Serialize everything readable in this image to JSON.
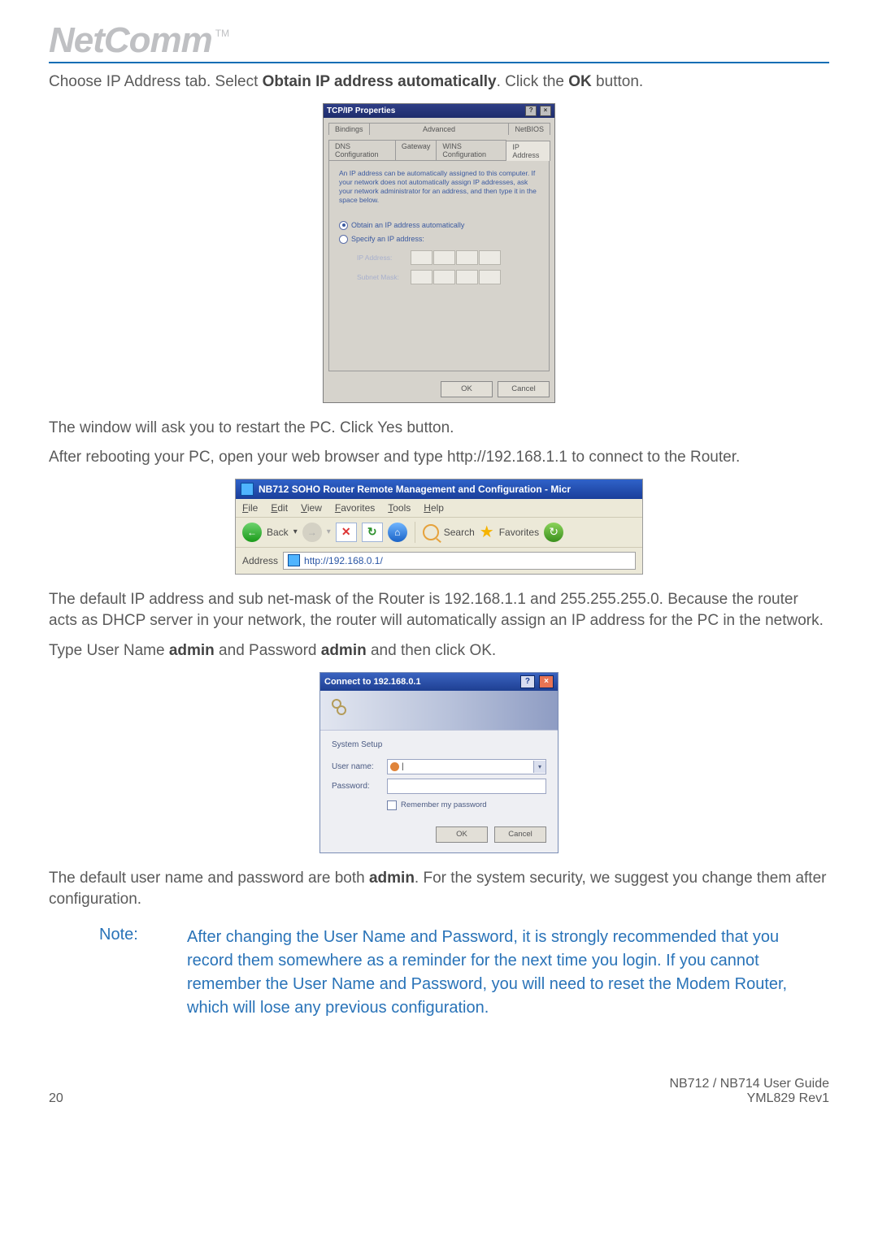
{
  "brand": {
    "name": "NetComm",
    "tm": "TM"
  },
  "p1": {
    "t1": "Choose IP Address tab. Select ",
    "b1": "Obtain IP address automatically",
    "t2": ". Click the ",
    "b2": "OK",
    "t3": " button."
  },
  "tcpip": {
    "title": "TCP/IP Properties",
    "win_help": "?",
    "win_close": "×",
    "tabs_top": {
      "bindings": "Bindings",
      "advanced": "Advanced",
      "netbios": "NetBIOS"
    },
    "tabs_bot": {
      "dns": "DNS Configuration",
      "gateway": "Gateway",
      "wins": "WINS Configuration",
      "ip": "IP Address"
    },
    "info": "An IP address can be automatically assigned to this computer. If your network does not automatically assign IP addresses, ask your network administrator for an address, and then type it in the space below.",
    "opt_auto": "Obtain an IP address automatically",
    "opt_spec": "Specify an IP address:",
    "ip_label": "IP Address:",
    "mask_label": "Subnet Mask:",
    "ok": "OK",
    "cancel": "Cancel"
  },
  "p2": "The window will ask you to restart the PC. Click Yes button.",
  "p3": "After rebooting your PC, open your web browser and type http://192.168.1.1 to connect to the Router.",
  "ie": {
    "title": "NB712 SOHO Router Remote Management and Configuration - Micr",
    "menu": {
      "file": "File",
      "edit": "Edit",
      "view": "View",
      "favorites": "Favorites",
      "tools": "Tools",
      "help": "Help"
    },
    "toolbar": {
      "back": "Back",
      "back_arrow": "←",
      "dd": "▾",
      "fwd": "→",
      "stop": "✕",
      "refresh": "↻",
      "home": "⌂",
      "search": "Search",
      "favorites": "Favorites",
      "star": "★",
      "hist": "↻"
    },
    "addr_label": "Address",
    "url": "http://192.168.0.1/"
  },
  "p4": "The default IP address and sub net-mask of the Router is 192.168.1.1 and 255.255.255.0. Because the router acts as DHCP server in your network, the router will automatically assign an IP address for the PC in the network.",
  "p5": {
    "t1": "Type User Name ",
    "b1": "admin",
    "t2": " and Password ",
    "b2": "admin",
    "t3": " and then click OK."
  },
  "conn": {
    "title": "Connect to 192.168.0.1",
    "help": "?",
    "close": "×",
    "subtitle": "System Setup",
    "user_label": "User name:",
    "pass_label": "Password:",
    "user_cursor": "|",
    "dd": "▾",
    "remember": "Remember my password",
    "ok": "OK",
    "cancel": "Cancel"
  },
  "p6": {
    "t1": "The default user name and password are both ",
    "b1": "admin",
    "t2": ". For the system security, we suggest you change them after configuration."
  },
  "note": {
    "label": "Note:",
    "body": "After changing the User Name and Password, it is strongly recommended that you record them somewhere as a reminder for the next time you login.  If you cannot remember the User Name and Password, you will need to reset the Modem Router, which will lose any previous configuration."
  },
  "footer": {
    "page_no": "20",
    "guide": "NB712 / NB714 User Guide",
    "rev": "YML829 Rev1"
  }
}
